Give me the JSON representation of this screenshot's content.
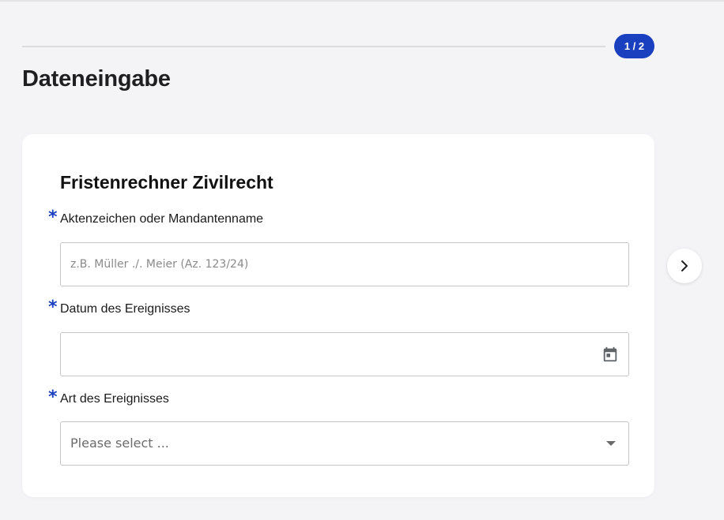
{
  "progress": {
    "step_label": "1 / 2",
    "current_step": 1,
    "total_steps": 2
  },
  "page": {
    "title": "Dateneingabe"
  },
  "form": {
    "title": "Fristenrechner Zivilrecht",
    "required_marker": "*",
    "fields": [
      {
        "label": "Aktenzeichen oder Mandantenname",
        "value": "",
        "placeholder": "z.B. Müller ./. Meier (Az. 123/24)",
        "required": true
      },
      {
        "label": "Datum des Ereignisses",
        "value": "",
        "placeholder": "",
        "required": true,
        "icon": "calendar-icon"
      },
      {
        "label": "Art des Ereignisses",
        "selected": "Please select ...",
        "required": true,
        "icon": "chevron-down-icon"
      }
    ]
  },
  "navigation": {
    "next_icon": "chevron-right-icon"
  },
  "colors": {
    "accent": "#1a3fbf",
    "background": "#f4f4f6",
    "card": "#ffffff"
  }
}
